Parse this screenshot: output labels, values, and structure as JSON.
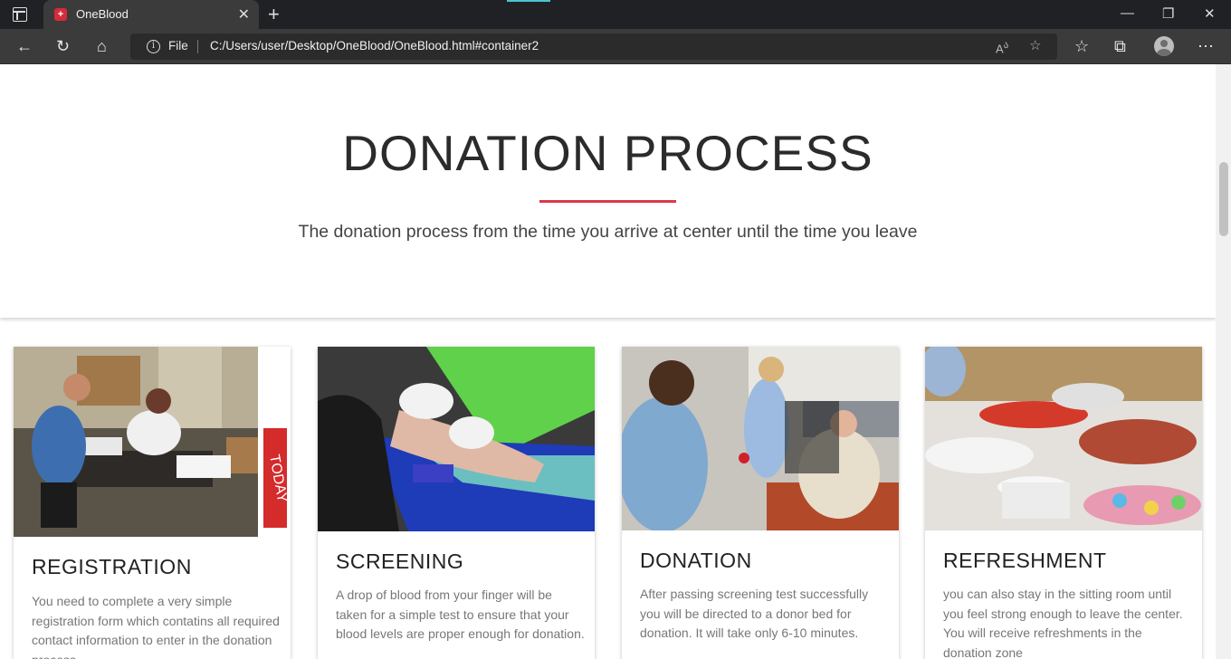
{
  "browser": {
    "tab_title": "OneBlood",
    "tab_favicon": "+",
    "address_label": "File",
    "url": "C:/Users/user/Desktop/OneBlood/OneBlood.html#container2"
  },
  "hero": {
    "title": "DONATION PROCESS",
    "subtitle": "The donation process from the time you arrive at center until the time you leave",
    "accent_color": "#e0374a"
  },
  "cards": [
    {
      "title": "REGISTRATION",
      "text": "You need to complete a very simple registration form which contatins all required contact information to enter in the donation process."
    },
    {
      "title": "SCREENING",
      "text": "A drop of blood from your finger will be taken for a simple test to ensure that your blood levels are proper enough for donation."
    },
    {
      "title": "DONATION",
      "text": "After passing screening test successfully you will be directed to a donor bed for donation. It will take only 6-10 minutes."
    },
    {
      "title": "REFRESHMENT",
      "text": "you can also stay in the sitting room until you feel strong enough to leave the center. You will receive refreshments in the donation zone"
    }
  ]
}
